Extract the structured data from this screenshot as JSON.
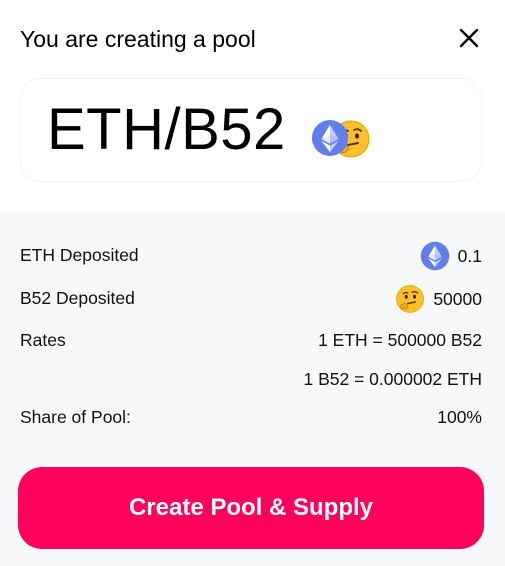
{
  "header": {
    "title": "You are creating a pool",
    "close_icon": "close-icon"
  },
  "pair": {
    "name": "ETH/B52",
    "token_a_icon": "eth-icon",
    "token_b_icon": "thinking-face-icon"
  },
  "details": {
    "eth_deposited_label": "ETH Deposited",
    "eth_deposited_value": "0.1",
    "b52_deposited_label": "B52 Deposited",
    "b52_deposited_value": "50000",
    "rates_label": "Rates",
    "rate_1": "1 ETH = 500000 B52",
    "rate_2": "1 B52 = 0.000002 ETH",
    "share_label": "Share of Pool:",
    "share_value": "100%"
  },
  "actions": {
    "create_label": "Create Pool & Supply"
  },
  "colors": {
    "accent": "#ff005a",
    "eth_blue": "#627eea",
    "panel_bg": "#f7f8fa"
  }
}
